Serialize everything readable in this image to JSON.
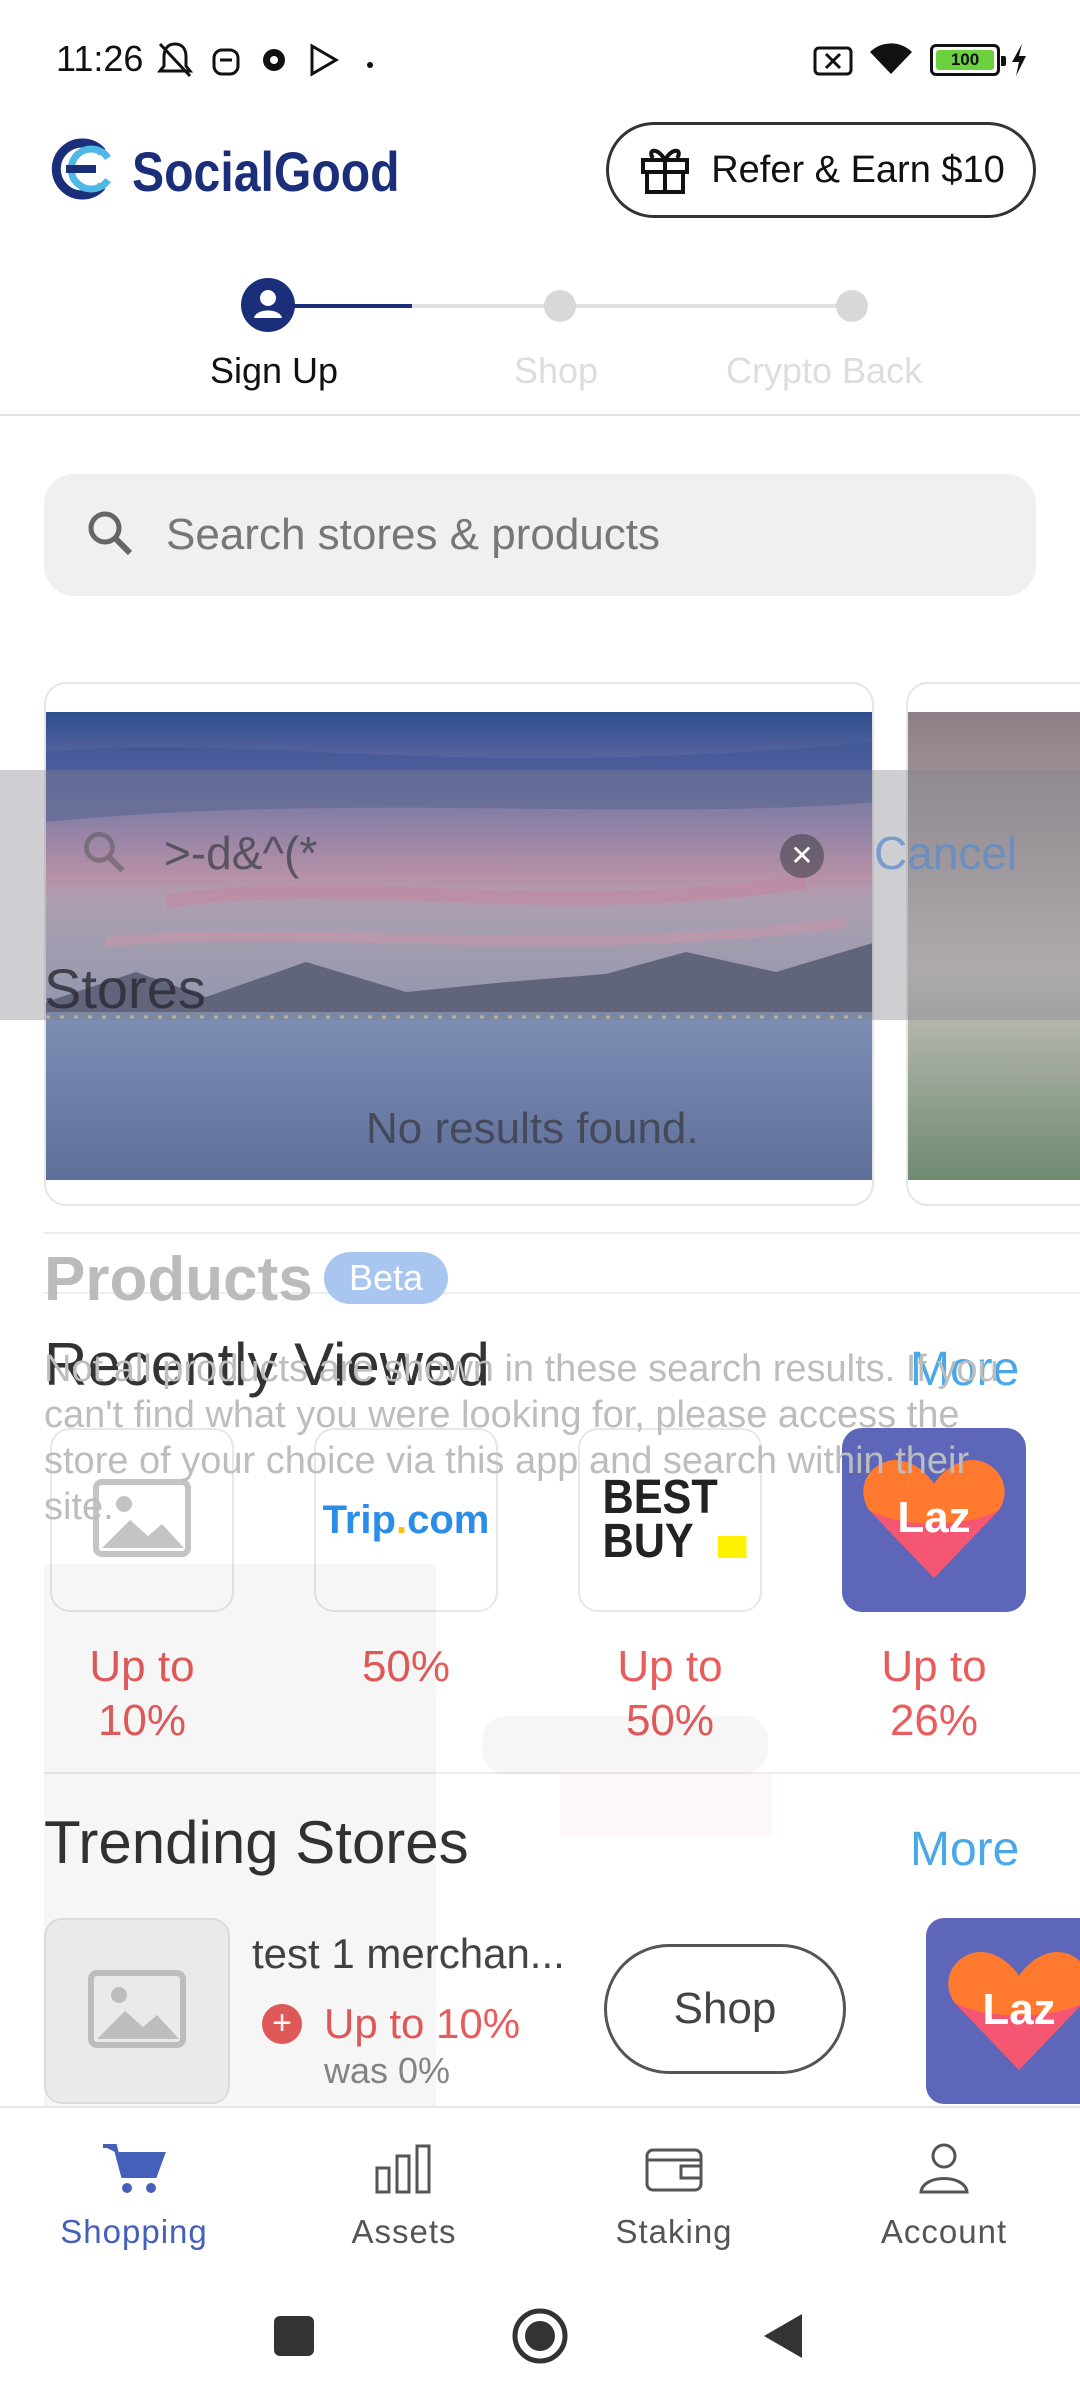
{
  "status_bar": {
    "time": "11:26",
    "battery": "100"
  },
  "header": {
    "brand": "SocialGood",
    "refer_label": "Refer & Earn $10"
  },
  "stepper": {
    "steps": [
      "Sign Up",
      "Shop",
      "Crypto Back"
    ],
    "active_index": 0
  },
  "search": {
    "placeholder": "Search stores & products"
  },
  "recently_viewed": {
    "title": "Recently Viewed",
    "more": "More",
    "items": [
      {
        "logo": "image-placeholder-icon",
        "offer_line1": "Up to",
        "offer_line2": "10%"
      },
      {
        "logo": "Trip.com",
        "offer_line1": "",
        "offer_line2": "50%"
      },
      {
        "logo": "BEST BUY",
        "offer_line1": "Up to",
        "offer_line2": "50%"
      },
      {
        "logo": "Laz",
        "offer_line1": "Up to",
        "offer_line2": "26%"
      }
    ]
  },
  "trending_stores": {
    "title": "Trending Stores",
    "more": "More",
    "item": {
      "name": "test 1 merchan...",
      "offer": "Up to 10%",
      "was": "was 0%",
      "button": "Shop",
      "next_logo": "Laz"
    }
  },
  "overlay": {
    "query": ">-d&^(*",
    "cancel": "Cancel",
    "stores_title": "Stores",
    "no_results": "No results found.",
    "products_title": "Products",
    "beta_badge": "Beta",
    "note": "Not all products are shown in these search results. If you can't find what you were looking for, please access the store of your choice via this app and search within their site."
  },
  "bottom_nav": {
    "items": [
      {
        "label": "Shopping",
        "icon": "cart-icon"
      },
      {
        "label": "Assets",
        "icon": "bar-chart-icon"
      },
      {
        "label": "Staking",
        "icon": "wallet-icon"
      },
      {
        "label": "Account",
        "icon": "person-icon"
      }
    ],
    "active": "Shopping"
  },
  "colors": {
    "brand": "#1b2e7a",
    "accent_link": "#4aa8e8",
    "offer_red": "#e85c5c",
    "nav_active": "#4560b8"
  }
}
